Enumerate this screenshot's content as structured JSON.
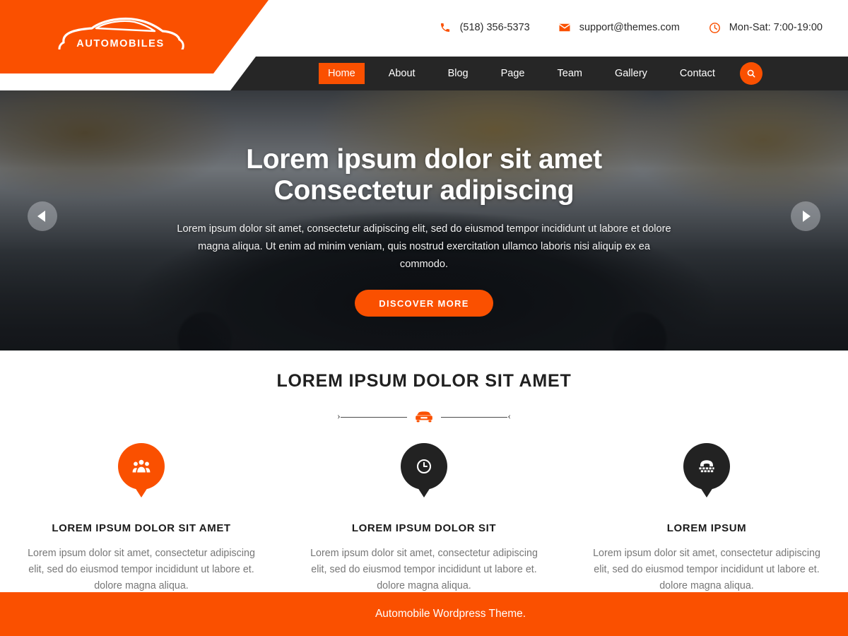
{
  "brand": {
    "logo_text": "AUTOMOBILES",
    "logo_icon": "car-outline-icon"
  },
  "colors": {
    "accent": "#FA5000",
    "nav_bg": "#262626",
    "dark_pin": "#222222",
    "body_text": "#777777",
    "heading": "#1b1b1b"
  },
  "topbar": {
    "contacts": [
      {
        "icon": "phone-icon",
        "text": "(518) 356-5373"
      },
      {
        "icon": "envelope-icon",
        "text": "support@themes.com"
      },
      {
        "icon": "clock-icon",
        "text": "Mon-Sat: 7:00-19:00"
      }
    ]
  },
  "nav": {
    "items": [
      {
        "label": "Home",
        "active": true
      },
      {
        "label": "About",
        "active": false
      },
      {
        "label": "Blog",
        "active": false
      },
      {
        "label": "Page",
        "active": false
      },
      {
        "label": "Team",
        "active": false
      },
      {
        "label": "Gallery",
        "active": false
      },
      {
        "label": "Contact",
        "active": false
      }
    ],
    "search_icon": "search-icon"
  },
  "hero": {
    "title_line1": "Lorem ipsum dolor sit amet",
    "title_line2": "Consectetur adipiscing",
    "description": "Lorem ipsum dolor sit amet, consectetur adipiscing elit, sed do eiusmod tempor incididunt ut labore et dolore magna aliqua. Ut enim ad minim veniam, quis nostrud exercitation ullamco laboris nisi aliquip ex ea commodo.",
    "cta_label": "DISCOVER MORE",
    "prev_icon": "chevron-left-icon",
    "next_icon": "chevron-right-icon"
  },
  "services": {
    "title": "LOREM IPSUM DOLOR SIT AMET",
    "divider_icon": "car-front-icon",
    "cards": [
      {
        "icon": "users-group-icon",
        "pin_style": "orange",
        "title": "LOREM IPSUM DOLOR SIT AMET",
        "text": "Lorem ipsum dolor sit amet, consectetur adipiscing elit, sed do eiusmod tempor incididunt ut labore et. dolore magna aliqua."
      },
      {
        "icon": "clock-icon",
        "pin_style": "dark",
        "title": "LOREM IPSUM DOLOR SIT",
        "text": "Lorem ipsum dolor sit amet, consectetur adipiscing elit, sed do eiusmod tempor incididunt ut labore et. dolore magna aliqua."
      },
      {
        "icon": "telephone-icon",
        "pin_style": "dark",
        "title": "LOREM IPSUM",
        "text": "Lorem ipsum dolor sit amet, consectetur adipiscing elit, sed do eiusmod tempor incididunt ut labore et. dolore magna aliqua."
      }
    ]
  },
  "footer": {
    "text": "Automobile Wordpress Theme."
  }
}
